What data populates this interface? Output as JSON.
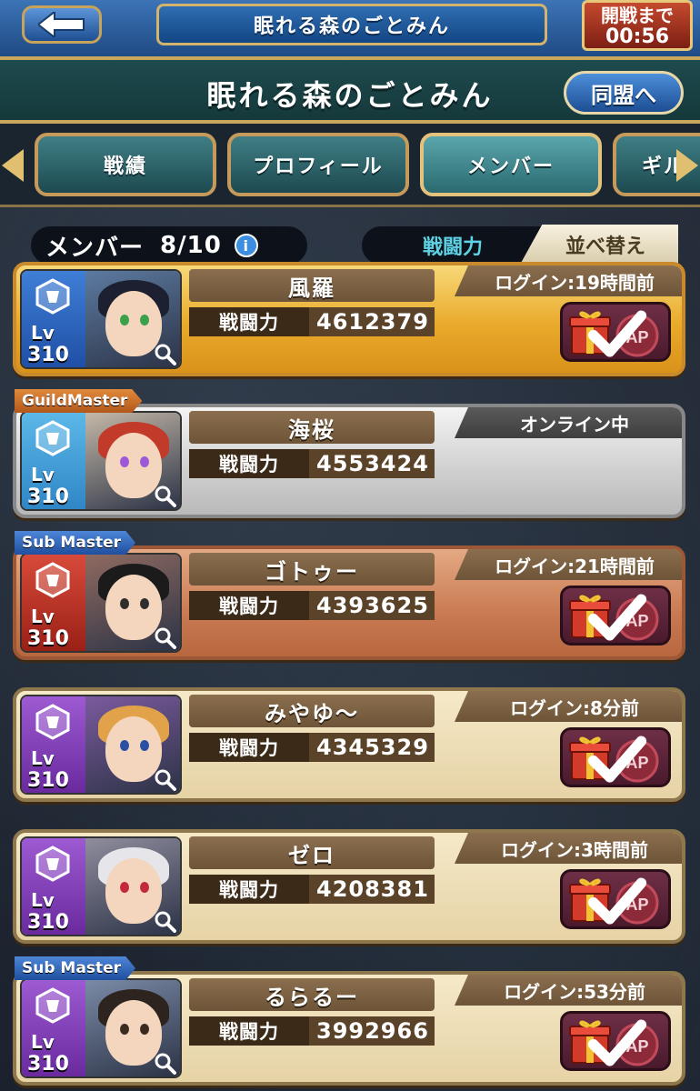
{
  "header": {
    "back_icon": "back-arrow-icon",
    "title": "眠れる森のごとみん",
    "timer_label": "開戦まで",
    "timer_value": "00:56"
  },
  "guild": {
    "name": "眠れる森のごとみん",
    "alliance_button": "同盟へ"
  },
  "tabs": [
    {
      "label": "戦績",
      "active": false
    },
    {
      "label": "プロフィール",
      "active": false
    },
    {
      "label": "メンバー",
      "active": true
    },
    {
      "label": "ギル",
      "active": false
    }
  ],
  "members_bar": {
    "count_label": "メンバー",
    "count_value": "8/10",
    "sort_current": "戦闘力",
    "sort_button": "並べ替え"
  },
  "power_label": "戦闘力",
  "lv_label": "Lv",
  "members": [
    {
      "name": "風羅",
      "level": "310",
      "power": "4612379",
      "status": "ログイン:19時間前",
      "style": "gold",
      "role": "",
      "gift_claimed": true
    },
    {
      "name": "海桜",
      "level": "310",
      "power": "4553424",
      "status": "オンライン中",
      "style": "silver",
      "role": "GuildMaster",
      "gift_claimed": false
    },
    {
      "name": "ゴトゥー",
      "level": "310",
      "power": "4393625",
      "status": "ログイン:21時間前",
      "style": "bronze",
      "role": "Sub Master",
      "gift_claimed": true
    },
    {
      "name": "みやゆ～",
      "level": "310",
      "power": "4345329",
      "status": "ログイン:8分前",
      "style": "plain",
      "role": "",
      "gift_claimed": true
    },
    {
      "name": "ゼロ",
      "level": "310",
      "power": "4208381",
      "status": "ログイン:3時間前",
      "style": "plain",
      "role": "",
      "gift_claimed": true
    },
    {
      "name": "るらるー",
      "level": "310",
      "power": "3992966",
      "status": "ログイン:53分前",
      "style": "plain",
      "role": "Sub Master",
      "gift_claimed": true
    }
  ],
  "colors": {
    "topbar": "#2f6db2",
    "guild_header": "#1e4a4e",
    "gold_border": "#c9a85e",
    "sort_active_text": "#5ed3e6"
  }
}
